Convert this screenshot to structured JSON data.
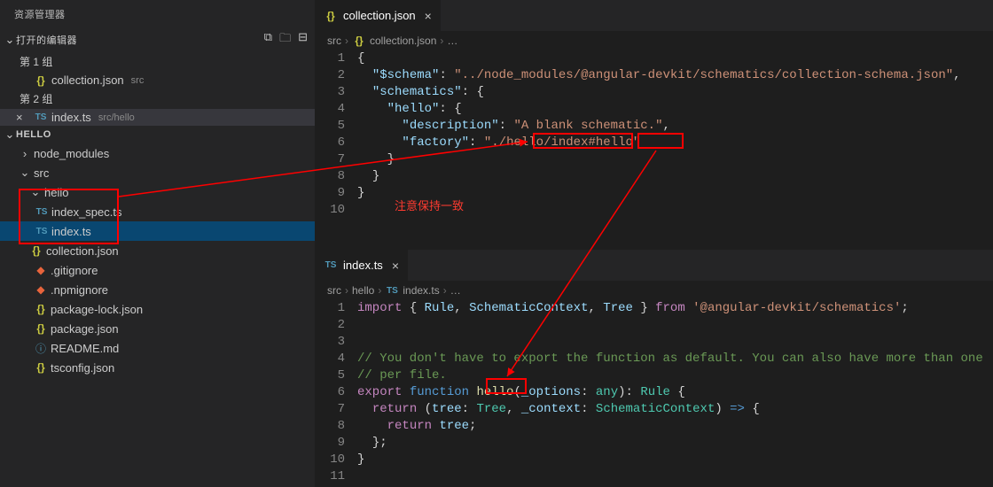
{
  "sidebar": {
    "title": "资源管理器",
    "openEditorsLabel": "打开的编辑器",
    "group1": "第 1 组",
    "group2": "第 2 组",
    "open1": {
      "name": "collection.json",
      "hint": "src"
    },
    "open2": {
      "name": "index.ts",
      "hint": "src/hello"
    },
    "projectHeader": "HELLO",
    "items": {
      "node_modules": "node_modules",
      "src": "src",
      "hello": "hello",
      "index_spec": "index_spec.ts",
      "index": "index.ts",
      "collection": "collection.json",
      "gitignore": ".gitignore",
      "npmignore": ".npmignore",
      "packagelock": "package-lock.json",
      "package": "package.json",
      "readme": "README.md",
      "tsconfig": "tsconfig.json"
    }
  },
  "pane1": {
    "tabName": "collection.json",
    "breadcrumb": {
      "p1": "src",
      "p2": "collection.json",
      "p3": "…"
    },
    "lineNumbers": [
      "1",
      "2",
      "3",
      "4",
      "5",
      "6",
      "7",
      "8",
      "9",
      "10"
    ],
    "code": {
      "schemaKey": "\"$schema\"",
      "schemaVal": "\"../node_modules/@angular-devkit/schematics/collection-schema.json\"",
      "schematicsKey": "\"schematics\"",
      "helloKey": "\"hello\"",
      "descKey": "\"description\"",
      "descVal": "\"A blank schematic.\"",
      "factoryKey": "\"factory\"",
      "factoryVal1": "\"./hello/index",
      "factoryVal2": "#hello\""
    }
  },
  "pane2": {
    "tabName": "index.ts",
    "breadcrumb": {
      "p1": "src",
      "p2": "hello",
      "p3": "index.ts",
      "p4": "…"
    },
    "lineNumbers": [
      "1",
      "2",
      "3",
      "4",
      "5",
      "6",
      "7",
      "8",
      "9",
      "10",
      "11"
    ],
    "code": {
      "import1a": "import",
      "import1b": "Rule",
      "import1c": "SchematicContext",
      "import1d": "Tree",
      "import1e": "from",
      "import1f": "'@angular-devkit/schematics'",
      "cmt1": "// You don't have to export the function as default. You can also have more than one",
      "cmt2": "// per file.",
      "kw_export": "export",
      "kw_function": "function",
      "fn_hello": "hello",
      "p_options": "_options",
      "t_any": "any",
      "t_Rule": "Rule",
      "kw_return": "return",
      "p_tree": "tree",
      "t_Tree": "Tree",
      "p_context": "_context",
      "t_sc": "SchematicContext",
      "ret_tree": "tree"
    }
  },
  "annotation": {
    "text": "注意保持一致"
  }
}
